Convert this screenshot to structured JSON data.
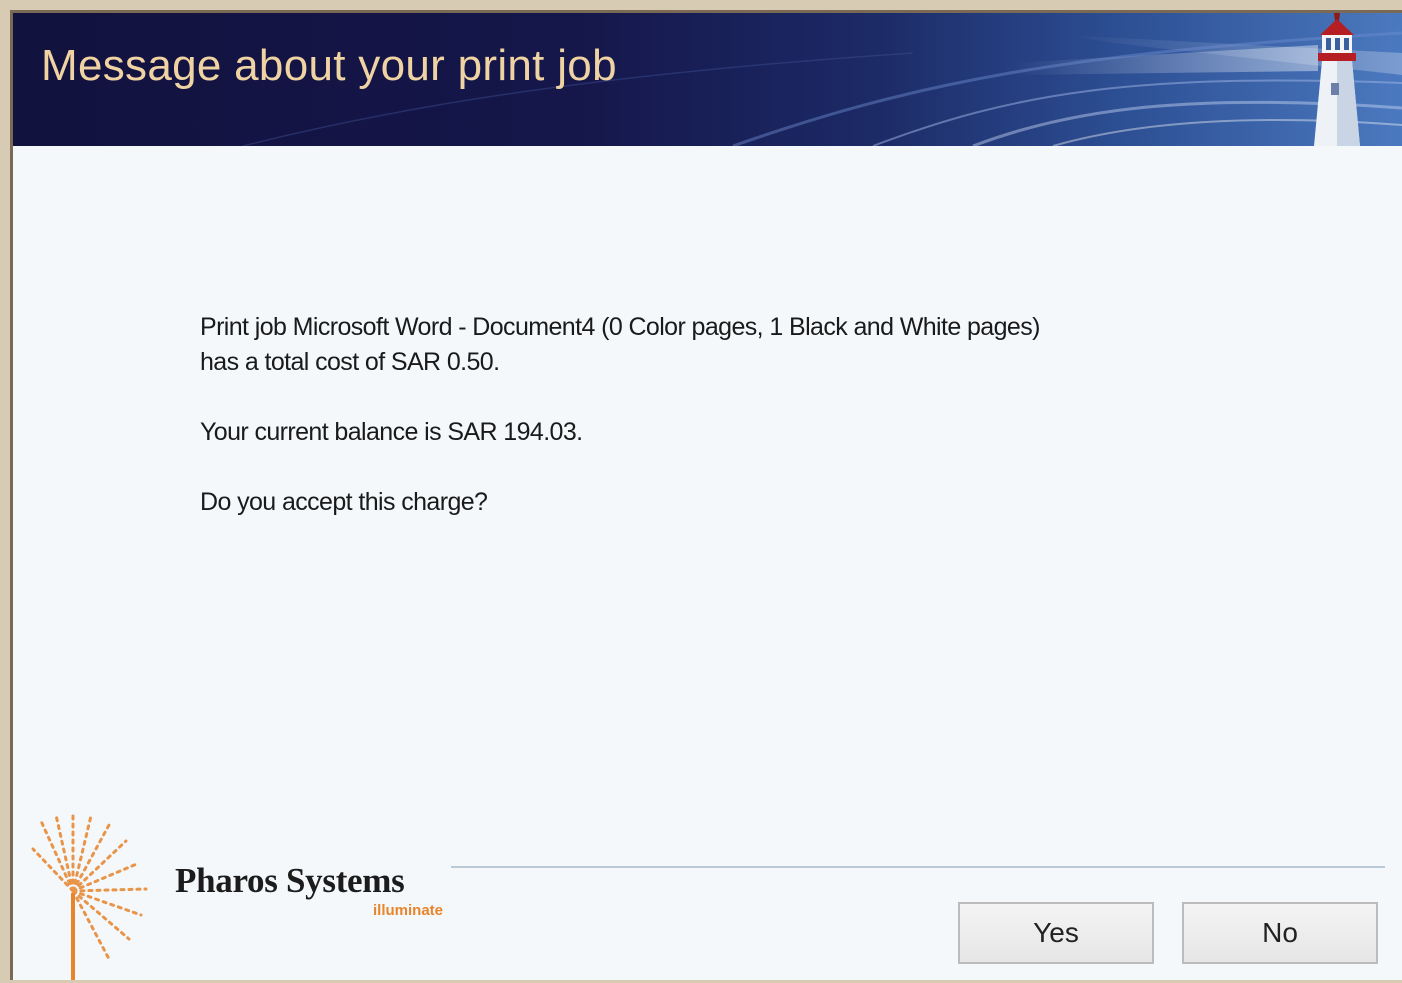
{
  "dialog": {
    "title": "Message about your print job",
    "message": {
      "line1": "Print job Microsoft Word - Document4 (0 Color pages, 1 Black and White pages)",
      "line2": "has a total cost of SAR 0.50.",
      "balance": "Your current balance is SAR 194.03.",
      "question": "Do you accept this charge?"
    },
    "logo": {
      "name": "Pharos Systems",
      "tagline": "illuminate"
    },
    "buttons": {
      "yes": "Yes",
      "no": "No"
    }
  },
  "colors": {
    "banner_dark": "#12123e",
    "banner_light": "#4b79bf",
    "title_text": "#f0d3a3",
    "logo_accent": "#e8842a",
    "body_bg": "#f4f8fb"
  },
  "icons": [
    "lighthouse-icon",
    "pharos-burst-logo-icon"
  ]
}
